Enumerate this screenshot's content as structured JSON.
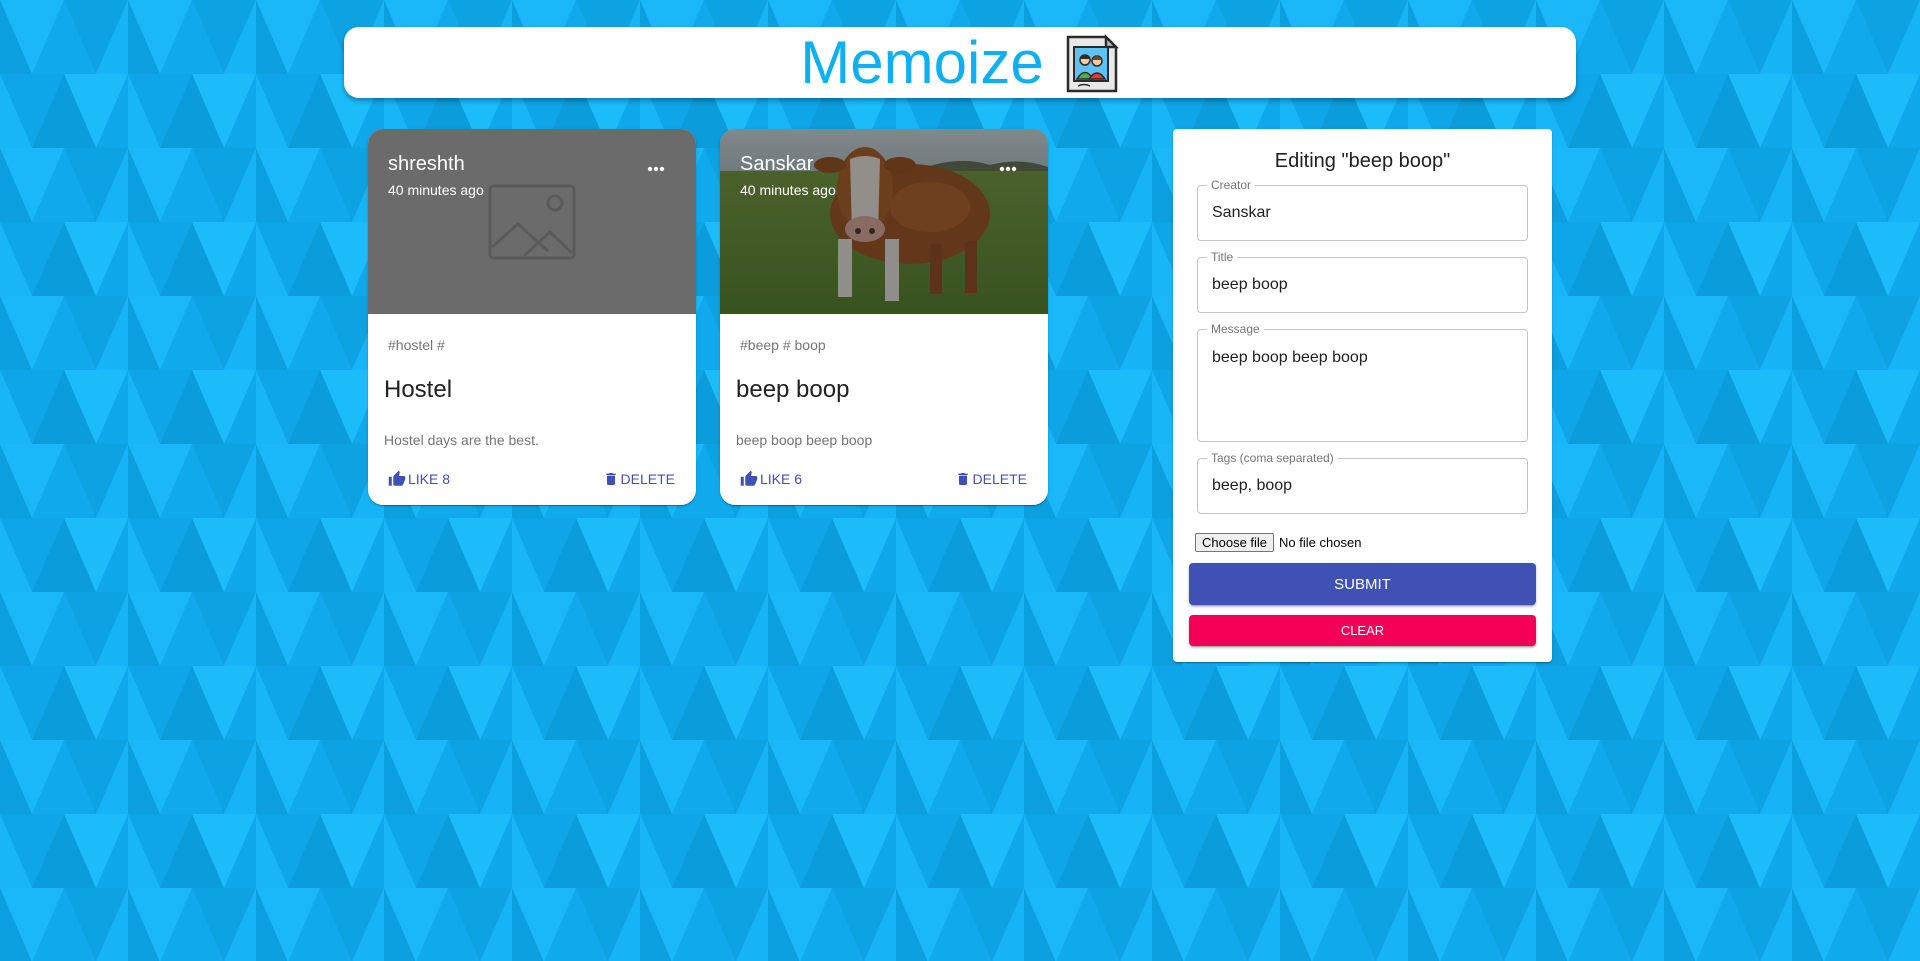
{
  "app": {
    "title": "Memoize",
    "logo_icon": "photo-album-icon",
    "accent_color": "#0fb0f2"
  },
  "posts": [
    {
      "creator": "shreshth",
      "time": "40 minutes ago",
      "tags": "#hostel #",
      "title": "Hostel",
      "message": "Hostel days are the best.",
      "like_label": "Like 8",
      "delete_label": "Delete",
      "image": "placeholder-image-icon"
    },
    {
      "creator": "Sanskar",
      "time": "40 minutes ago",
      "tags": "#beep # boop",
      "title": "beep boop",
      "message": "beep boop beep boop",
      "like_label": "Like 6",
      "delete_label": "Delete",
      "image": "cow-photo"
    }
  ],
  "form": {
    "heading": "Editing \"beep boop\"",
    "creator_label": "Creator",
    "creator_value": "Sanskar",
    "title_label": "Title",
    "title_value": "beep boop",
    "message_label": "Message",
    "message_value": "beep boop beep boop",
    "tags_label": "Tags (coma separated)",
    "tags_value": "beep, boop",
    "file_button": "Choose file",
    "file_status": "No file chosen",
    "submit_label": "Submit",
    "clear_label": "Clear",
    "submit_color": "#3f51b5",
    "clear_color": "#f50057"
  }
}
